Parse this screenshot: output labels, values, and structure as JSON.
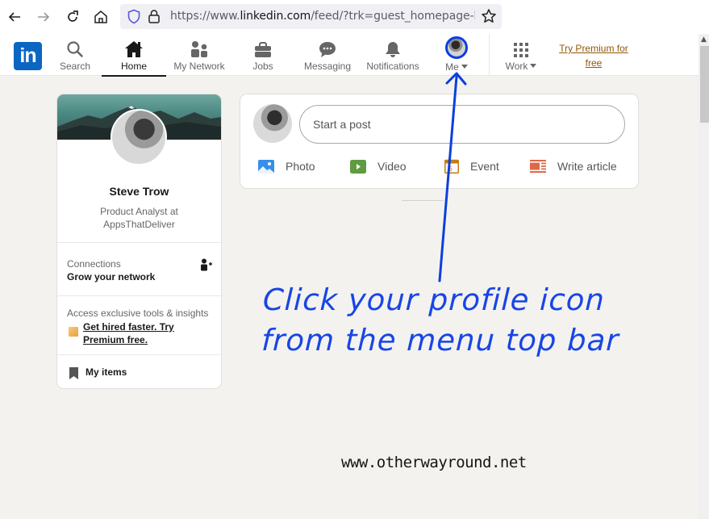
{
  "browser": {
    "url_prefix": "https://www.",
    "url_domain": "linkedin.com",
    "url_rest": "/feed/?trk=guest_homepage-basic_n",
    "icons": [
      "back-icon",
      "forward-icon",
      "reload-icon",
      "home-icon",
      "shield-icon",
      "lock-icon",
      "bookmark-star-icon"
    ]
  },
  "header": {
    "logo": "in",
    "nav": [
      {
        "label": "Search",
        "icon": "search-icon"
      },
      {
        "label": "Home",
        "icon": "home-icon",
        "active": true
      },
      {
        "label": "My Network",
        "icon": "network-icon"
      },
      {
        "label": "Jobs",
        "icon": "briefcase-icon"
      },
      {
        "label": "Messaging",
        "icon": "messaging-icon"
      },
      {
        "label": "Notifications",
        "icon": "bell-icon"
      },
      {
        "label": "Me",
        "icon": "avatar",
        "has_dropdown": true
      },
      {
        "label": "Work",
        "icon": "grid-icon",
        "has_dropdown": true
      }
    ],
    "premium_line1": "Try Premium for",
    "premium_line2": "free"
  },
  "profile": {
    "name": "Steve Trow",
    "headline": "Product Analyst at AppsThatDeliver",
    "connections_label": "Connections",
    "connections_sub": "Grow your network",
    "access_text": "Access exclusive tools & insights",
    "premium_cta": "Get hired faster. Try Premium free.",
    "my_items": "My items"
  },
  "post_box": {
    "placeholder": "Start a post",
    "actions": [
      {
        "label": "Photo",
        "icon": "photo-icon",
        "color": "#378fe9"
      },
      {
        "label": "Video",
        "icon": "video-icon",
        "color": "#5f9b41"
      },
      {
        "label": "Event",
        "icon": "event-icon",
        "color": "#c37d16"
      },
      {
        "label": "Write article",
        "icon": "article-icon",
        "color": "#e06847"
      }
    ]
  },
  "annotation": {
    "line1": "Click your profile icon",
    "line2": "from the menu top bar",
    "color": "#1845e6"
  },
  "watermark": "www.otherwayround.net",
  "colors": {
    "brand": "#0a66c2",
    "premium": "#915907",
    "background": "#f3f2ef"
  }
}
